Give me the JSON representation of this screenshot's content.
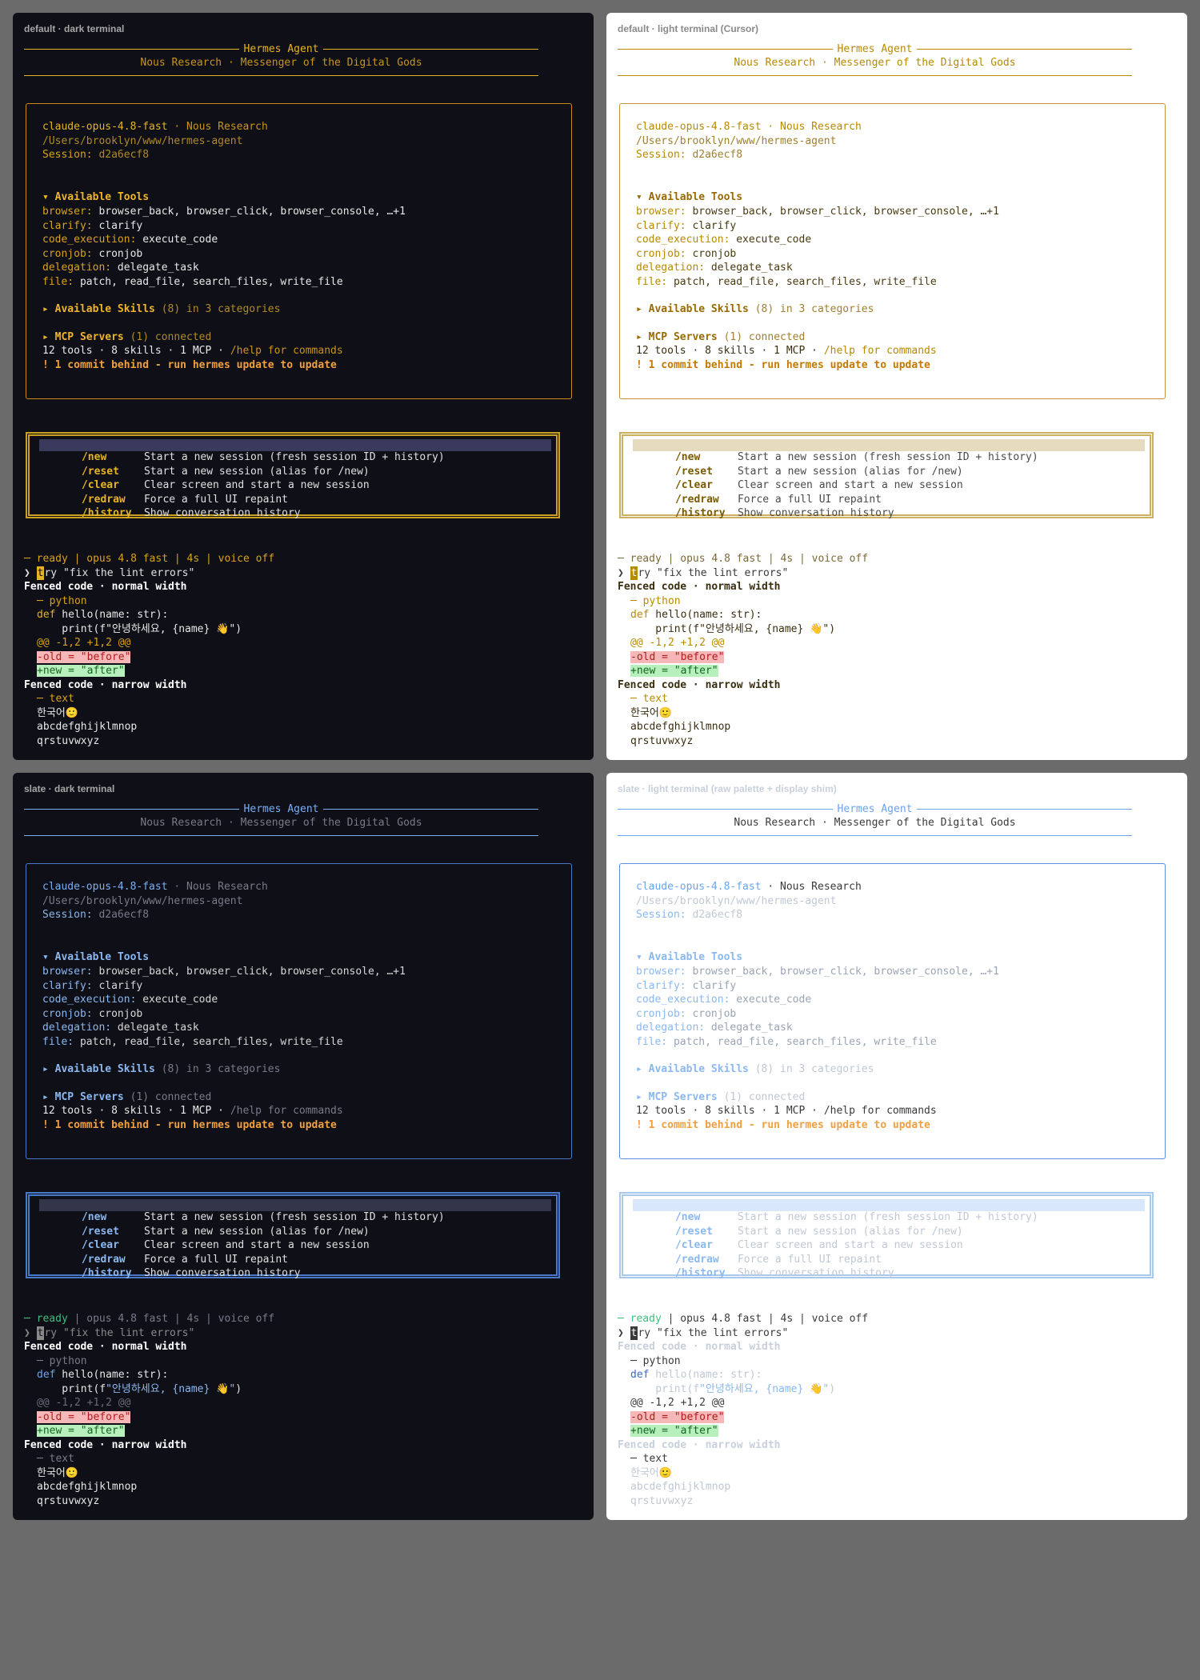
{
  "banner": {
    "title": "Hermes Agent",
    "subtitle": "Nous Research · Messenger of the Digital Gods"
  },
  "session": {
    "model": "claude-opus-4.8-fast",
    "model_sep": " · ",
    "vendor": "Nous Research",
    "path": "/Users/brooklyn/www/hermes-agent",
    "session_label": "Session:",
    "session_id": "d2a6ecf8"
  },
  "tools": {
    "header": "▾ Available Tools",
    "items": [
      {
        "label": "browser:",
        "value": "browser_back, browser_click, browser_console, …+1"
      },
      {
        "label": "clarify:",
        "value": "clarify"
      },
      {
        "label": "code_execution:",
        "value": "execute_code"
      },
      {
        "label": "cronjob:",
        "value": "cronjob"
      },
      {
        "label": "delegation:",
        "value": "delegate_task"
      },
      {
        "label": "file:",
        "value": "patch, read_file, search_files, write_file"
      }
    ]
  },
  "skills": {
    "header": "▸ Available Skills",
    "count": "(8) in 3 categories"
  },
  "mcp": {
    "header": "▸ MCP Servers",
    "count": "(1) connected"
  },
  "summary": {
    "stats": "12 tools · 8 skills · 1 MCP · ",
    "help": "/help for commands"
  },
  "warning": "! 1 commit behind - run hermes update to update",
  "menu": [
    {
      "cmd": "/new",
      "desc": "Start a new session (fresh session ID + history)"
    },
    {
      "cmd": "/reset",
      "desc": "Start a new session (alias for /new)"
    },
    {
      "cmd": "/clear",
      "desc": "Clear screen and start a new session"
    },
    {
      "cmd": "/redraw",
      "desc": "Force a full UI repaint"
    },
    {
      "cmd": "/history",
      "desc": "Show conversation history"
    }
  ],
  "status": {
    "ready": "─ ready",
    "rest": " | opus 4.8 fast | 4s | voice off"
  },
  "prompt": {
    "symbol": "❯ ",
    "cursor_char": "t",
    "text": "ry \"fix the lint errors\""
  },
  "code": {
    "normal_heading": "Fenced code · normal width",
    "python_label": "─ python",
    "def_kw": "def",
    "sig": " hello(name: str):",
    "print_pre": "    print(f",
    "print_str": "\"안녕하세요, {name} 👋\"",
    "print_post": ")",
    "hunk": "@@ -1,2 +1,2 @@",
    "del": "-old = \"before\"",
    "add": "+new = \"after\"",
    "narrow_heading": "Fenced code · narrow width",
    "text_label": "─ text",
    "kor": "한국어🙂",
    "alpha1": "abcdefghijklmnop",
    "alpha2": "qrstuvwxyz"
  },
  "panels": [
    {
      "title": "default · dark terminal",
      "theme": "default-dark"
    },
    {
      "title": "default · light terminal (Cursor)",
      "theme": "default-light"
    },
    {
      "title": "slate · dark terminal",
      "theme": "slate-dark"
    },
    {
      "title": "slate · light terminal (raw palette + display shim)",
      "theme": "slate-light"
    }
  ],
  "colors": {
    "dark_bg": "#0f0f17",
    "light_bg": "#ffffff",
    "page_bg": "#6b6b6b",
    "default_dark_accent": "#e6b422",
    "default_dark_muted": "#c9951a",
    "default_light_accent": "#b88a00",
    "slate_dark_accent": "#6aa4f0",
    "slate_light_accent": "#5b9be0",
    "warning": "#f0a040",
    "ready_green": "#3fbf7f"
  }
}
